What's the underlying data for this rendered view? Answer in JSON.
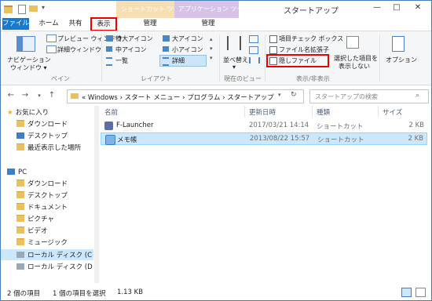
{
  "titlebar": {
    "context_shortcut": "ショートカット ツール",
    "context_app": "アプリケーション ツール",
    "title": "スタートアップ",
    "min": "—",
    "max": "□",
    "close": "✕"
  },
  "tabs": {
    "file": "ファイル",
    "home": "ホーム",
    "share": "共有",
    "view": "表示",
    "manage1": "管理",
    "manage2": "管理"
  },
  "ribbon": {
    "nav_pane": "ナビゲーション",
    "nav_pane2": "ウィンドウ ▾",
    "preview": "プレビュー ウィンドウ",
    "details_pane": "詳細ウィンドウ",
    "group_pane": "ペイン",
    "xl_icons": "特大アイコン",
    "l_icons": "大アイコン",
    "m_icons": "中アイコン",
    "s_icons": "小アイコン",
    "list": "一覧",
    "details": "詳細",
    "group_layout": "レイアウト",
    "sort": "並べ替え",
    "group_current": "現在のビュー",
    "item_checkbox": "項目チェック ボックス",
    "ext": "ファイル名拡張子",
    "hidden": "隠しファイル",
    "hide_selected1": "選択した項目を",
    "hide_selected2": "表示しない",
    "group_showhide": "表示/非表示",
    "options": "オプション"
  },
  "address": {
    "path": [
      "«",
      "Windows",
      "›",
      "スタート メニュー",
      "›",
      "プログラム",
      "›",
      "スタートアップ"
    ],
    "search_placeholder": "スタートアップの検索"
  },
  "nav": {
    "favorites": "お気に入り",
    "downloads": "ダウンロード",
    "desktop": "デスクトップ",
    "recent": "最近表示した場所",
    "pc": "PC",
    "pc_downloads": "ダウンロード",
    "pc_desktop": "デスクトップ",
    "documents": "ドキュメント",
    "pictures": "ピクチャ",
    "videos": "ビデオ",
    "music": "ミュージック",
    "local_c": "ローカル ディスク (C",
    "local_d": "ローカル ディスク (D"
  },
  "columns": {
    "name": "名前",
    "date": "更新日時",
    "type": "種類",
    "size": "サイズ"
  },
  "files": [
    {
      "name": "F-Launcher",
      "date": "2017/03/21 14:14",
      "type": "ショートカット",
      "size": "2 KB"
    },
    {
      "name": "メモ帳",
      "date": "2013/08/22 15:57",
      "type": "ショートカット",
      "size": "2 KB"
    }
  ],
  "status": {
    "count": "2 個の項目",
    "selected": "1 個の項目を選択",
    "size": "1.13 KB"
  },
  "colors": {
    "accent": "#1979ca",
    "highlight": "#e00000",
    "selection": "#cce8ff"
  }
}
